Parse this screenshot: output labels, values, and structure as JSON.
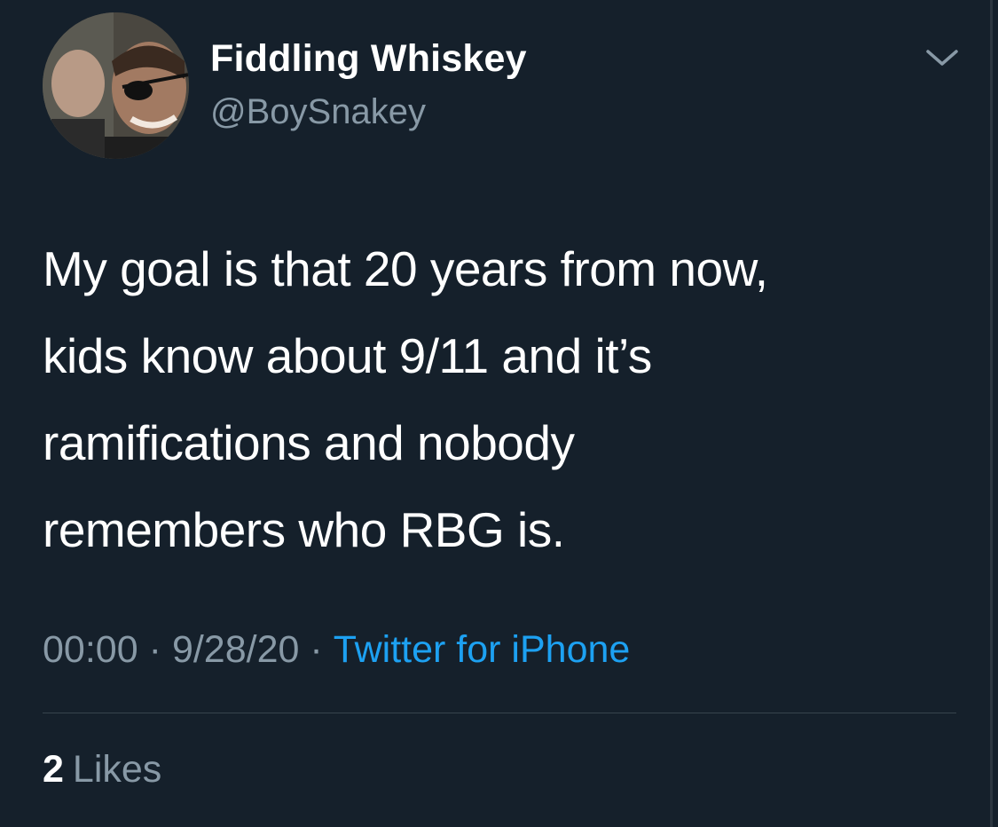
{
  "author": {
    "display_name": "Fiddling Whiskey",
    "handle": "@BoySnakey",
    "avatar_icon": "profile-photo"
  },
  "tweet": {
    "lines": [
      "My goal is that 20 years from now,",
      "kids know about 9/11 and it’s",
      "ramifications and nobody",
      "remembers who RBG is."
    ]
  },
  "meta": {
    "time": "00:00",
    "separator": "·",
    "date": "9/28/20",
    "source": "Twitter for iPhone"
  },
  "stats": {
    "likes_count": "2",
    "likes_label": "Likes"
  },
  "colors": {
    "background": "#15202b",
    "text_primary": "#ffffff",
    "text_secondary": "#8899a6",
    "link": "#1da1f2",
    "divider": "#38444d"
  },
  "icons": {
    "menu": "chevron-down-icon"
  }
}
